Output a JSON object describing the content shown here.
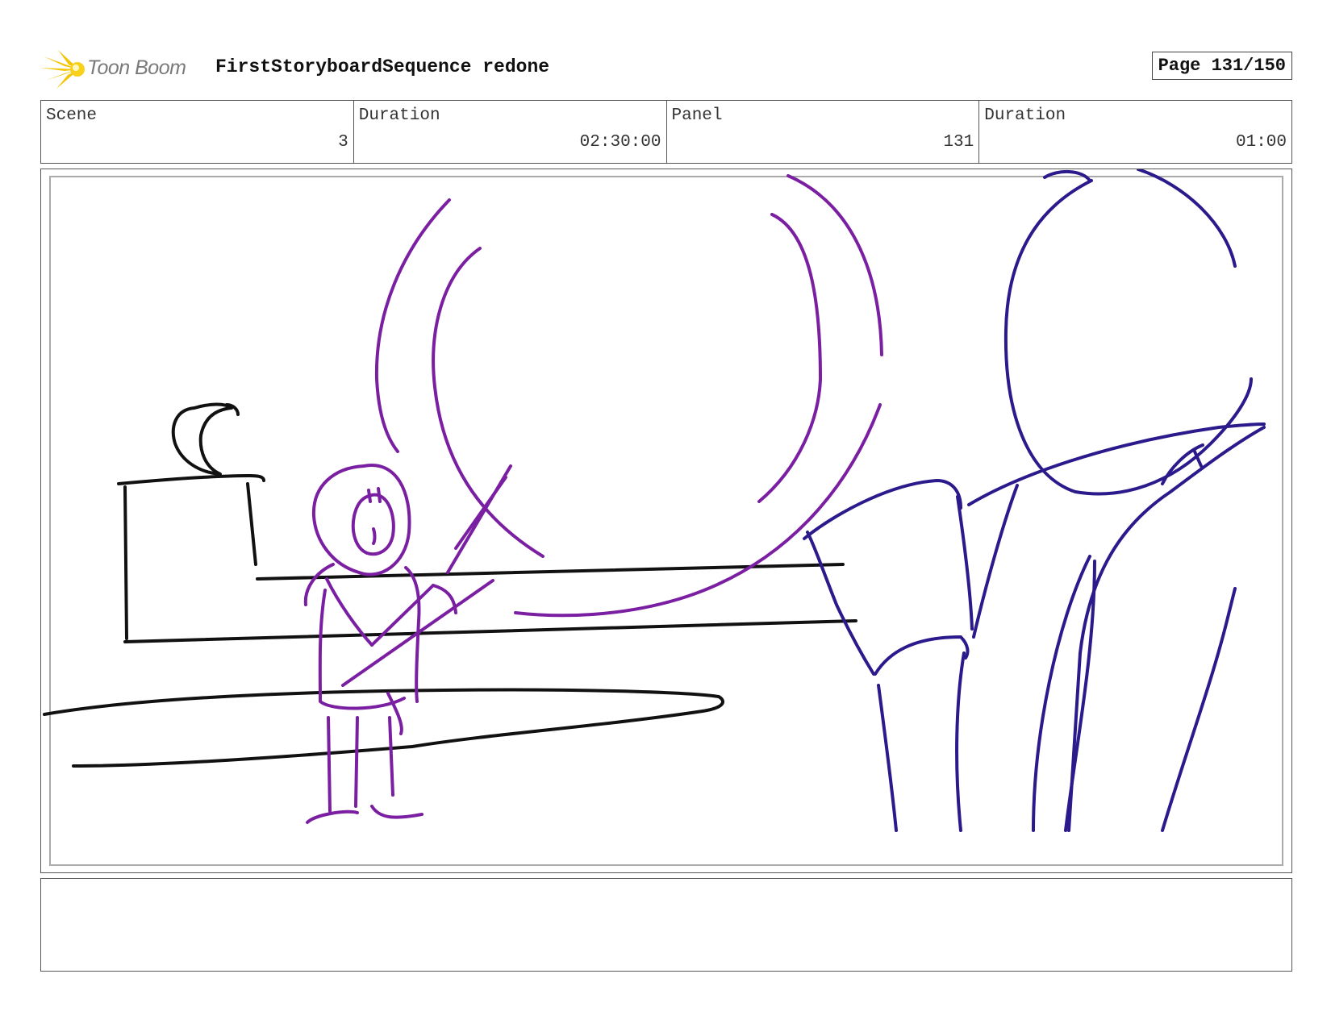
{
  "header": {
    "logo_text": "Toon Boom",
    "title": "FirstStoryboardSequence redone",
    "page": "Page 131/150"
  },
  "info": [
    {
      "label": "Scene",
      "value": "3"
    },
    {
      "label": "Duration",
      "value": "02:30:00"
    },
    {
      "label": "Panel",
      "value": "131"
    },
    {
      "label": "Duration",
      "value": "01:00"
    }
  ],
  "colors": {
    "sketch_black": "#111111",
    "sketch_purple": "#7b1fa2",
    "sketch_blue": "#2a1a8c",
    "logo_yellow": "#f5c400"
  },
  "notes": {
    "text": ""
  }
}
